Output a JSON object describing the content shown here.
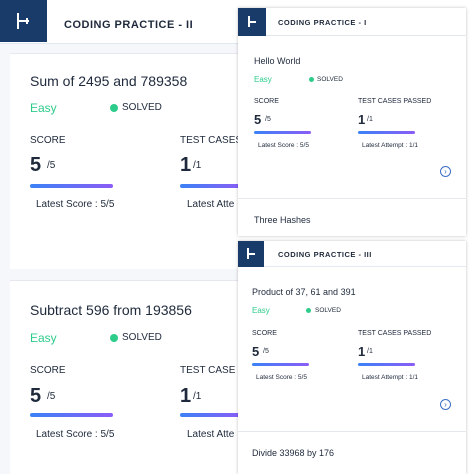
{
  "panel_big": {
    "header_title": "CODING PRACTICE - II",
    "cards": [
      {
        "question": "Sum of 2495 and 789358",
        "difficulty": "Easy",
        "status": "SOLVED",
        "score_label": "SCORE",
        "score": "5",
        "score_total": "/5",
        "tests_label": "TEST CASES",
        "tests": "1",
        "tests_total": "/1",
        "latest_score": "Latest Score : 5/5",
        "latest_attempt": "Latest Atte"
      },
      {
        "question": "Subtract 596 from 193856",
        "difficulty": "Easy",
        "status": "SOLVED",
        "score_label": "SCORE",
        "score": "5",
        "score_total": "/5",
        "tests_label": "TEST CASE",
        "tests": "1",
        "tests_total": "/1",
        "latest_score": "Latest Score : 5/5",
        "latest_attempt": "Latest Atte"
      }
    ]
  },
  "panel_top": {
    "header_title": "CODING PRACTICE - I",
    "card": {
      "question": "Hello World",
      "difficulty": "Easy",
      "status": "SOLVED",
      "score_label": "SCORE",
      "score": "5",
      "score_total": "/5",
      "tests_label": "TEST CASES PASSED",
      "tests": "1",
      "tests_total": "/1",
      "latest_score": "Latest Score : 5/5",
      "latest_attempt": "Latest Attempt : 1/1"
    },
    "next_question": "Three Hashes"
  },
  "panel_bottom": {
    "header_title": "CODING PRACTICE - III",
    "card": {
      "question": "Product of 37, 61 and 391",
      "difficulty": "Easy",
      "status": "SOLVED",
      "score_label": "SCORE",
      "score": "5",
      "score_total": "/5",
      "tests_label": "TEST CASES PASSED",
      "tests": "1",
      "tests_total": "/1",
      "latest_score": "Latest Score : 5/5",
      "latest_attempt": "Latest Attempt : 1/1"
    },
    "next_question": "Divide 33968 by 176"
  },
  "icons": {
    "logo": "sidebar-toggle-icon",
    "open": "arrow-right-circle-icon",
    "status": "green-dot-icon"
  },
  "colors": {
    "brand": "#183b6a",
    "easy": "#2ecc8b",
    "progress_start": "#3b82f6",
    "progress_end": "#8b5cf6"
  }
}
